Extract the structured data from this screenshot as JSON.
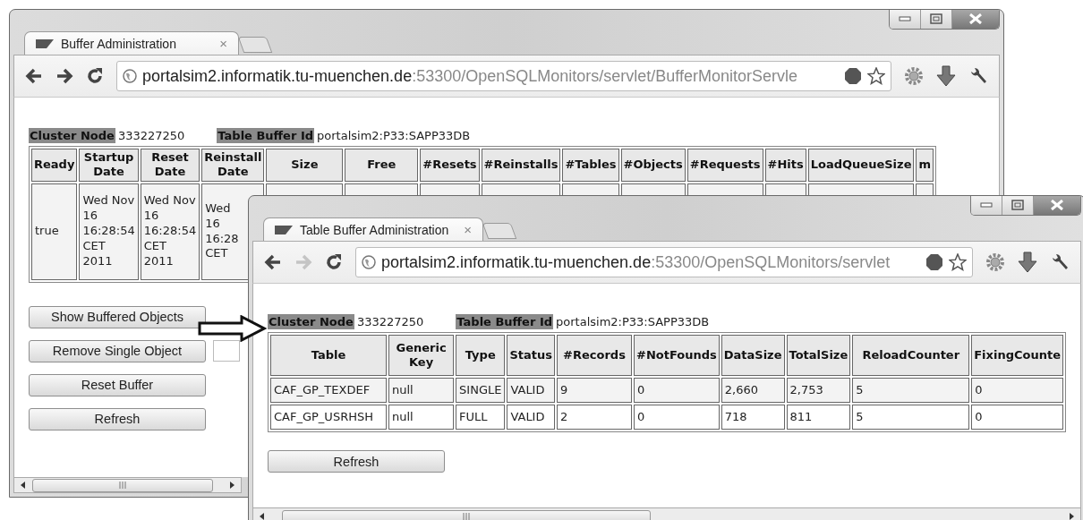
{
  "windows": [
    {
      "kind": "back",
      "tab": {
        "title": "Buffer Administration",
        "close": "×"
      },
      "url": {
        "host": "portalsim2.informatik.tu-muenchen.de",
        "rest": ":53300/OpenSQLMonitors/servlet/BufferMonitorServle"
      },
      "forward_enabled": true,
      "info": [
        {
          "label": "Cluster Node",
          "value": "333227250"
        },
        {
          "label": "Table Buffer Id",
          "value": "portalsim2:P33:SAPP33DB"
        }
      ],
      "table": {
        "columns": [
          "Ready",
          "Startup Date",
          "Reset Date",
          "Reinstall Date",
          "Size",
          "Free",
          "#Resets",
          "#Reinstalls",
          "#Tables",
          "#Objects",
          "#Requests",
          "#Hits",
          "LoadQueueSize",
          "m"
        ],
        "rows": [
          [
            "true",
            "Wed Nov 16 16:28:54 CET 2011",
            "Wed Nov 16 16:28:54 CET 2011",
            "Wed 16 16:28 CET"
          ]
        ]
      },
      "buttons": [
        {
          "kind": "button",
          "label": "Show Buffered Objects"
        },
        {
          "kind": "button_with_field",
          "label": "Remove Single Object"
        },
        {
          "kind": "button",
          "label": "Reset Buffer"
        },
        {
          "kind": "button",
          "label": "Refresh"
        }
      ]
    },
    {
      "kind": "front",
      "tab": {
        "title": "Table Buffer Administration",
        "close": "×"
      },
      "url": {
        "host": "portalsim2.informatik.tu-muenchen.de",
        "rest": ":53300/OpenSQLMonitors/servlet"
      },
      "forward_enabled": false,
      "info": [
        {
          "label": "Cluster Node",
          "value": "333227250"
        },
        {
          "label": "Table Buffer Id",
          "value": "portalsim2:P33:SAPP33DB"
        }
      ],
      "table": {
        "columns": [
          "Table",
          "Generic Key",
          "Type",
          "Status",
          "#Records",
          "#NotFounds",
          "DataSize",
          "TotalSize",
          "ReloadCounter",
          "FixingCounte"
        ],
        "rows": [
          [
            "CAF_GP_TEXDEF",
            "null",
            "SINGLE",
            "VALID",
            "9",
            "0",
            "2,660",
            "2,753",
            "5",
            "0"
          ],
          [
            "CAF_GP_USRHSH",
            "null",
            "FULL",
            "VALID",
            "2",
            "0",
            "718",
            "811",
            "5",
            "0"
          ]
        ]
      },
      "buttons": [
        {
          "kind": "button",
          "label": "Refresh"
        }
      ]
    }
  ]
}
